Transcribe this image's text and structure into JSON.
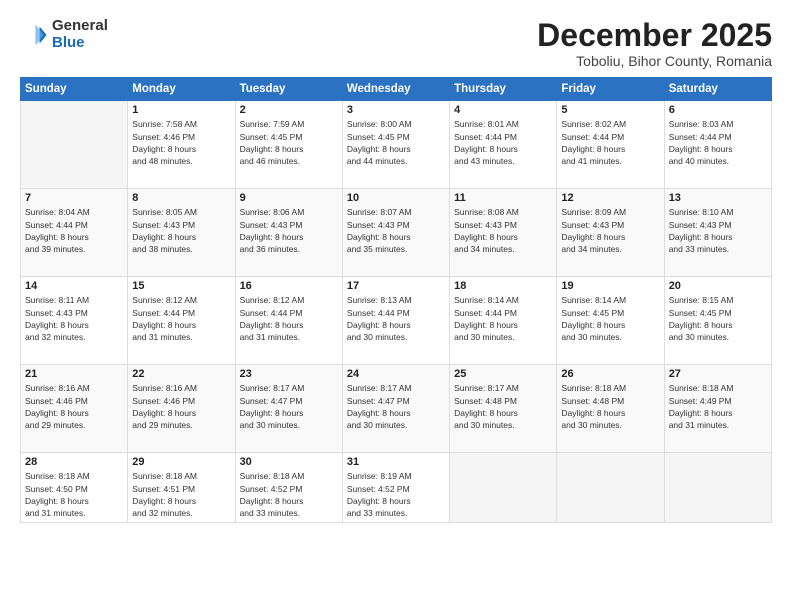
{
  "logo": {
    "general": "General",
    "blue": "Blue"
  },
  "title": {
    "main": "December 2025",
    "sub": "Toboliu, Bihor County, Romania"
  },
  "weekdays": [
    "Sunday",
    "Monday",
    "Tuesday",
    "Wednesday",
    "Thursday",
    "Friday",
    "Saturday"
  ],
  "weeks": [
    [
      {
        "day": "",
        "content": ""
      },
      {
        "day": "1",
        "content": "Sunrise: 7:58 AM\nSunset: 4:46 PM\nDaylight: 8 hours\nand 48 minutes."
      },
      {
        "day": "2",
        "content": "Sunrise: 7:59 AM\nSunset: 4:45 PM\nDaylight: 8 hours\nand 46 minutes."
      },
      {
        "day": "3",
        "content": "Sunrise: 8:00 AM\nSunset: 4:45 PM\nDaylight: 8 hours\nand 44 minutes."
      },
      {
        "day": "4",
        "content": "Sunrise: 8:01 AM\nSunset: 4:44 PM\nDaylight: 8 hours\nand 43 minutes."
      },
      {
        "day": "5",
        "content": "Sunrise: 8:02 AM\nSunset: 4:44 PM\nDaylight: 8 hours\nand 41 minutes."
      },
      {
        "day": "6",
        "content": "Sunrise: 8:03 AM\nSunset: 4:44 PM\nDaylight: 8 hours\nand 40 minutes."
      }
    ],
    [
      {
        "day": "7",
        "content": "Sunrise: 8:04 AM\nSunset: 4:44 PM\nDaylight: 8 hours\nand 39 minutes."
      },
      {
        "day": "8",
        "content": "Sunrise: 8:05 AM\nSunset: 4:43 PM\nDaylight: 8 hours\nand 38 minutes."
      },
      {
        "day": "9",
        "content": "Sunrise: 8:06 AM\nSunset: 4:43 PM\nDaylight: 8 hours\nand 36 minutes."
      },
      {
        "day": "10",
        "content": "Sunrise: 8:07 AM\nSunset: 4:43 PM\nDaylight: 8 hours\nand 35 minutes."
      },
      {
        "day": "11",
        "content": "Sunrise: 8:08 AM\nSunset: 4:43 PM\nDaylight: 8 hours\nand 34 minutes."
      },
      {
        "day": "12",
        "content": "Sunrise: 8:09 AM\nSunset: 4:43 PM\nDaylight: 8 hours\nand 34 minutes."
      },
      {
        "day": "13",
        "content": "Sunrise: 8:10 AM\nSunset: 4:43 PM\nDaylight: 8 hours\nand 33 minutes."
      }
    ],
    [
      {
        "day": "14",
        "content": "Sunrise: 8:11 AM\nSunset: 4:43 PM\nDaylight: 8 hours\nand 32 minutes."
      },
      {
        "day": "15",
        "content": "Sunrise: 8:12 AM\nSunset: 4:44 PM\nDaylight: 8 hours\nand 31 minutes."
      },
      {
        "day": "16",
        "content": "Sunrise: 8:12 AM\nSunset: 4:44 PM\nDaylight: 8 hours\nand 31 minutes."
      },
      {
        "day": "17",
        "content": "Sunrise: 8:13 AM\nSunset: 4:44 PM\nDaylight: 8 hours\nand 30 minutes."
      },
      {
        "day": "18",
        "content": "Sunrise: 8:14 AM\nSunset: 4:44 PM\nDaylight: 8 hours\nand 30 minutes."
      },
      {
        "day": "19",
        "content": "Sunrise: 8:14 AM\nSunset: 4:45 PM\nDaylight: 8 hours\nand 30 minutes."
      },
      {
        "day": "20",
        "content": "Sunrise: 8:15 AM\nSunset: 4:45 PM\nDaylight: 8 hours\nand 30 minutes."
      }
    ],
    [
      {
        "day": "21",
        "content": "Sunrise: 8:16 AM\nSunset: 4:46 PM\nDaylight: 8 hours\nand 29 minutes."
      },
      {
        "day": "22",
        "content": "Sunrise: 8:16 AM\nSunset: 4:46 PM\nDaylight: 8 hours\nand 29 minutes."
      },
      {
        "day": "23",
        "content": "Sunrise: 8:17 AM\nSunset: 4:47 PM\nDaylight: 8 hours\nand 30 minutes."
      },
      {
        "day": "24",
        "content": "Sunrise: 8:17 AM\nSunset: 4:47 PM\nDaylight: 8 hours\nand 30 minutes."
      },
      {
        "day": "25",
        "content": "Sunrise: 8:17 AM\nSunset: 4:48 PM\nDaylight: 8 hours\nand 30 minutes."
      },
      {
        "day": "26",
        "content": "Sunrise: 8:18 AM\nSunset: 4:48 PM\nDaylight: 8 hours\nand 30 minutes."
      },
      {
        "day": "27",
        "content": "Sunrise: 8:18 AM\nSunset: 4:49 PM\nDaylight: 8 hours\nand 31 minutes."
      }
    ],
    [
      {
        "day": "28",
        "content": "Sunrise: 8:18 AM\nSunset: 4:50 PM\nDaylight: 8 hours\nand 31 minutes."
      },
      {
        "day": "29",
        "content": "Sunrise: 8:18 AM\nSunset: 4:51 PM\nDaylight: 8 hours\nand 32 minutes."
      },
      {
        "day": "30",
        "content": "Sunrise: 8:18 AM\nSunset: 4:52 PM\nDaylight: 8 hours\nand 33 minutes."
      },
      {
        "day": "31",
        "content": "Sunrise: 8:19 AM\nSunset: 4:52 PM\nDaylight: 8 hours\nand 33 minutes."
      },
      {
        "day": "",
        "content": ""
      },
      {
        "day": "",
        "content": ""
      },
      {
        "day": "",
        "content": ""
      }
    ]
  ]
}
